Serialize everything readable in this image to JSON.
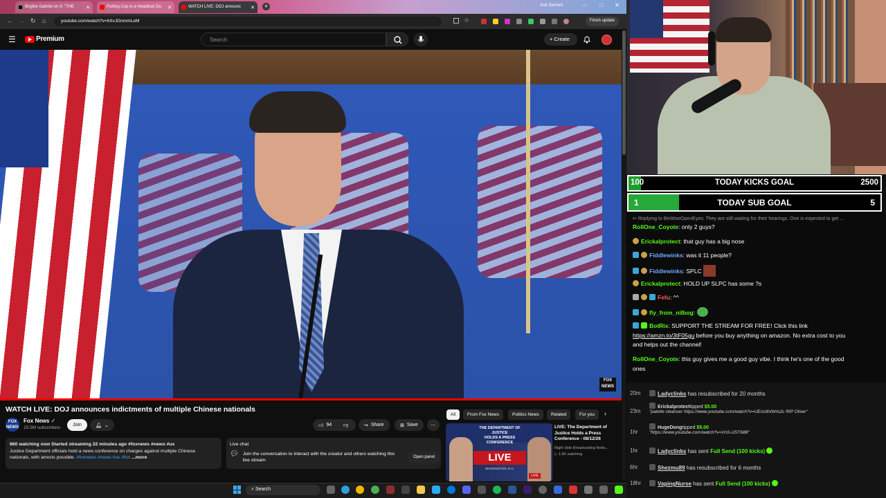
{
  "browser": {
    "tabs": [
      {
        "label": "Brigitte Gabriel on X: \"THE"
      },
      {
        "label": "Putting Cop in a Headlock Du"
      },
      {
        "label": "WATCH LIVE: DOJ announc"
      }
    ],
    "ask_gemini": "Ask Gemini",
    "url": "youtube.com/watch?v=hXvJGnmmLeM",
    "finish_update": "Finish update"
  },
  "youtube": {
    "logo_text": "Premium",
    "search_placeholder": "Search",
    "create_label": "Create",
    "video_title": "WATCH LIVE: DOJ announces indictments of multiple Chinese nationals",
    "channel_name": "Fox News",
    "subscribers": "15.5M subscribers",
    "join_label": "Join",
    "likes": "94",
    "share_label": "Share",
    "save_label": "Save",
    "description": {
      "stats": "860 watching now  Started streaming 22 minutes ago  #foxnews #news #us",
      "line1": "Justice Department officials hold a news conference on charges against multiple Chinese",
      "line2": "nationals, with arrests possible.",
      "tags": "#foxnews #news #us #fox",
      "more": "...more"
    },
    "live_chat": {
      "title": "Live chat",
      "text": "Join the conversation to interact with the creator and others watching this live stream.",
      "open_panel": "Open panel"
    },
    "chips": [
      "All",
      "From Fox News",
      "Politics News",
      "Related",
      "For you"
    ],
    "recommended": {
      "title": "LIVE: The Department of Justice Holds a Press Conference - 08/12/26",
      "channel": "Right Side Broadcasting Netw...",
      "watching": "1.6K watching",
      "thumb_text1": "THE DEPARTMENT OF JUSTICE",
      "thumb_text2": "HOLDS A PRESS CONFERENCE",
      "thumb_live": "LIVE",
      "thumb_city": "WASHINGTON, D.C.",
      "thumb_badge": "LIVE"
    }
  },
  "taskbar": {
    "search": "Search"
  },
  "goals": {
    "kicks": {
      "left": "100",
      "label": "TODAY KICKS GOAL",
      "right": "2500"
    },
    "subs": {
      "left": "1",
      "label": "TODAY SUB GOAL",
      "right": "5",
      "progress": 0.2
    }
  },
  "chat": {
    "reply_hint": "Replying to BeWiseOpenEyes: They are still waiting for their hearings. One is expected to get ...",
    "messages": [
      {
        "user": "RollOne_Coyote",
        "text": ": only 2 guys?",
        "color": "#53fc18"
      },
      {
        "user": "Erickalprotect",
        "text": ": that guy has a big nose",
        "color": "#53fc18"
      },
      {
        "user": "Fiddlewinks",
        "text": ": was it 11 people?",
        "color": "#6fa8ff"
      },
      {
        "user": "Fiddlewinks",
        "text": ": SPLC",
        "color": "#6fa8ff"
      },
      {
        "user": "Erickalprotect",
        "text": ": HOLD UP SLPC has some ?s",
        "color": "#53fc18"
      },
      {
        "user": "Fefu",
        "text": ": ^^",
        "color": "#ff5a5a"
      },
      {
        "user": "fly_from_nilbog",
        "text": ":",
        "color": "#53fc18"
      },
      {
        "user": "BotRix",
        "text": ": SUPPORT THE STREAM FOR FREE! Click this link",
        "color": "#53fc18"
      },
      {
        "user": "RollOne_Coyote",
        "text": ": this guy gives me a good guy vibe. I think he's one of the good",
        "color": "#53fc18"
      }
    ],
    "botrix_link": "https://amzn.to/3tF05gu",
    "botrix_rest": " before you buy anything on amazon. No extra cost to you",
    "botrix_rest2": "and helps out the channel!",
    "last_cont": "ones"
  },
  "events": [
    {
      "time": "20m",
      "user": "Ladyclinks",
      "text": "has resubscribed for 20 months"
    },
    {
      "time": "23m",
      "user": "Erickalprotect",
      "text": "tipped",
      "amount": "$5.00",
      "sub": "\"palette cleanser https://www.youtube.com/watch?v=UEoU6VbHs2c RIP Oliver\""
    },
    {
      "time": "1hr",
      "user": "HugeDong",
      "text": "tipped",
      "amount": "$5.00",
      "sub": "\"https://www.youtube.com/watch?v=VnS-iJST688\""
    },
    {
      "time": "1hr",
      "user": "Ladyclinks",
      "text": "has sent",
      "amount": "Full Send (100 kicks)"
    },
    {
      "time": "6hr",
      "user": "Shezmu89",
      "text": "has resubscribed for 6 months"
    },
    {
      "time": "18hr",
      "user": "VapingNurse",
      "text": "has sent",
      "amount": "Full Send (100 kicks)"
    }
  ]
}
